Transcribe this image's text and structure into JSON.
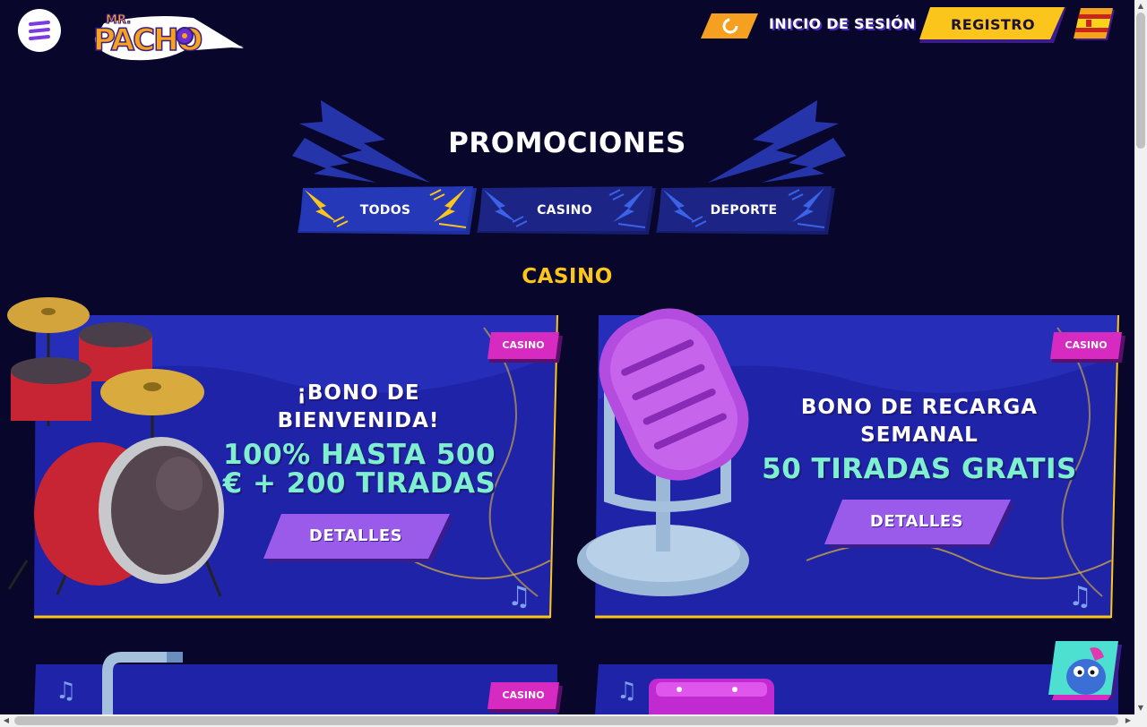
{
  "header": {
    "logo_text_top": "MR.",
    "logo_text_main": "PACHO",
    "login_label": "INICIO DE SESIÓN",
    "register_label": "REGISTRO",
    "language_icon": "spain-flag-icon",
    "menu_icon": "hamburger-icon"
  },
  "page": {
    "title": "PROMOCIONES",
    "filters": [
      {
        "label": "TODOS",
        "active": true
      },
      {
        "label": "CASINO",
        "active": false
      },
      {
        "label": "DEPORTE",
        "active": false
      }
    ],
    "section_title": "CASINO"
  },
  "promos": [
    {
      "tag": "CASINO",
      "title_line1": "¡BONO DE",
      "title_line2": "BIENVENIDA!",
      "offer_line1": "100% HASTA 500",
      "offer_line2": "€ + 200 TIRADAS",
      "button": "DETALLES",
      "art": "drum-kit"
    },
    {
      "tag": "CASINO",
      "title_line1": "BONO DE RECARGA",
      "title_line2": "SEMANAL",
      "offer_line1": "50 TIRADAS GRATIS",
      "button": "DETALLES",
      "art": "microphone"
    },
    {
      "tag": "CASINO",
      "art": "saxophone"
    },
    {
      "art": "keyboard"
    }
  ],
  "colors": {
    "background": "#08062b",
    "card_blue": "#1f23a8",
    "accent_yellow": "#fbc51b",
    "accent_purple": "#9b5bea",
    "accent_pink": "#d62ac0",
    "offer_mint": "#7ff0cf"
  }
}
